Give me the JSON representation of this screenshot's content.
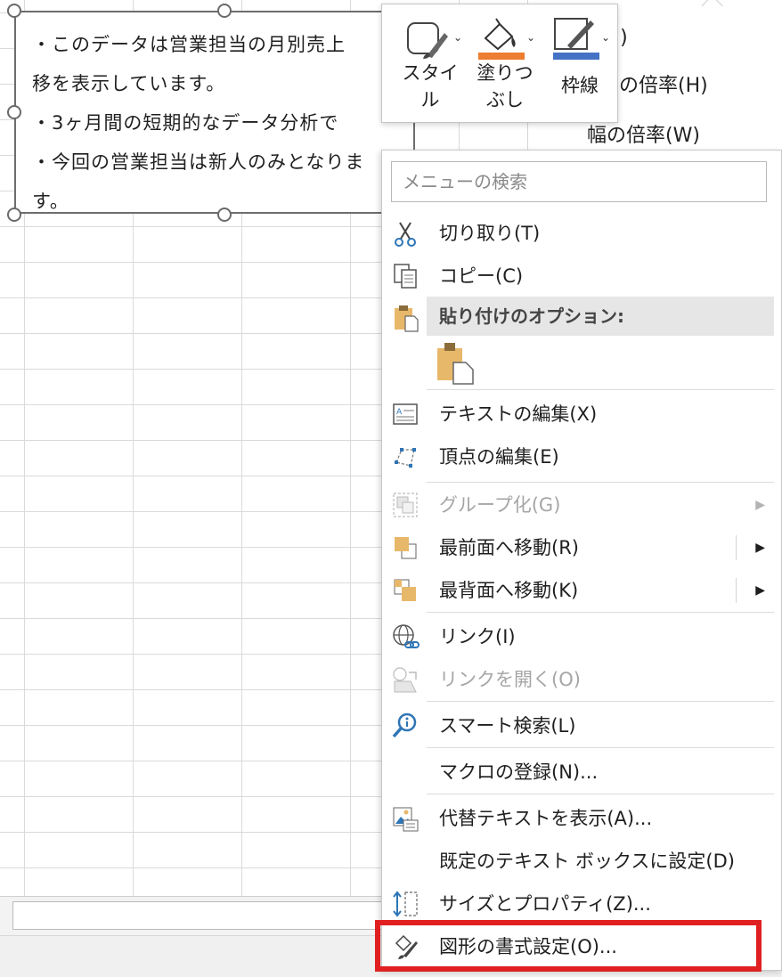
{
  "textbox": {
    "lines": [
      "・このデータは営業担当の月別売上",
      "移を表示しています。",
      "・3ヶ月間の短期的なデータ分析で",
      "・今回の営業担当は新人のみとなりま",
      "す。"
    ]
  },
  "format_pane": {
    "item_partial": "ム(I)",
    "height_scale": "さの倍率(H)",
    "width_scale": "幅の倍率(W)"
  },
  "mini_toolbar": {
    "style_label_1": "スタイ",
    "style_label_2": "ル",
    "fill_label_1": "塗りつ",
    "fill_label_2": "ぶし",
    "outline_label": "枠線",
    "fill_color": "#ed7d31",
    "outline_color": "#4472c4"
  },
  "context_menu": {
    "search_placeholder": "メニューの検索",
    "items": {
      "cut": "切り取り(T)",
      "copy": "コピー(C)",
      "paste_options": "貼り付けのオプション:",
      "edit_text": "テキストの編集(X)",
      "edit_points": "頂点の編集(E)",
      "group": "グループ化(G)",
      "bring_to_front": "最前面へ移動(R)",
      "send_to_back": "最背面へ移動(K)",
      "link": "リンク(I)",
      "open_link": "リンクを開く(O)",
      "smart_lookup": "スマート検索(L)",
      "assign_macro": "マクロの登録(N)...",
      "alt_text": "代替テキストを表示(A)...",
      "set_default_textbox": "既定のテキスト ボックスに設定(D)",
      "size_properties": "サイズとプロパティ(Z)...",
      "format_shape": "図形の書式設定(O)..."
    }
  },
  "highlight_color": "#e02020"
}
